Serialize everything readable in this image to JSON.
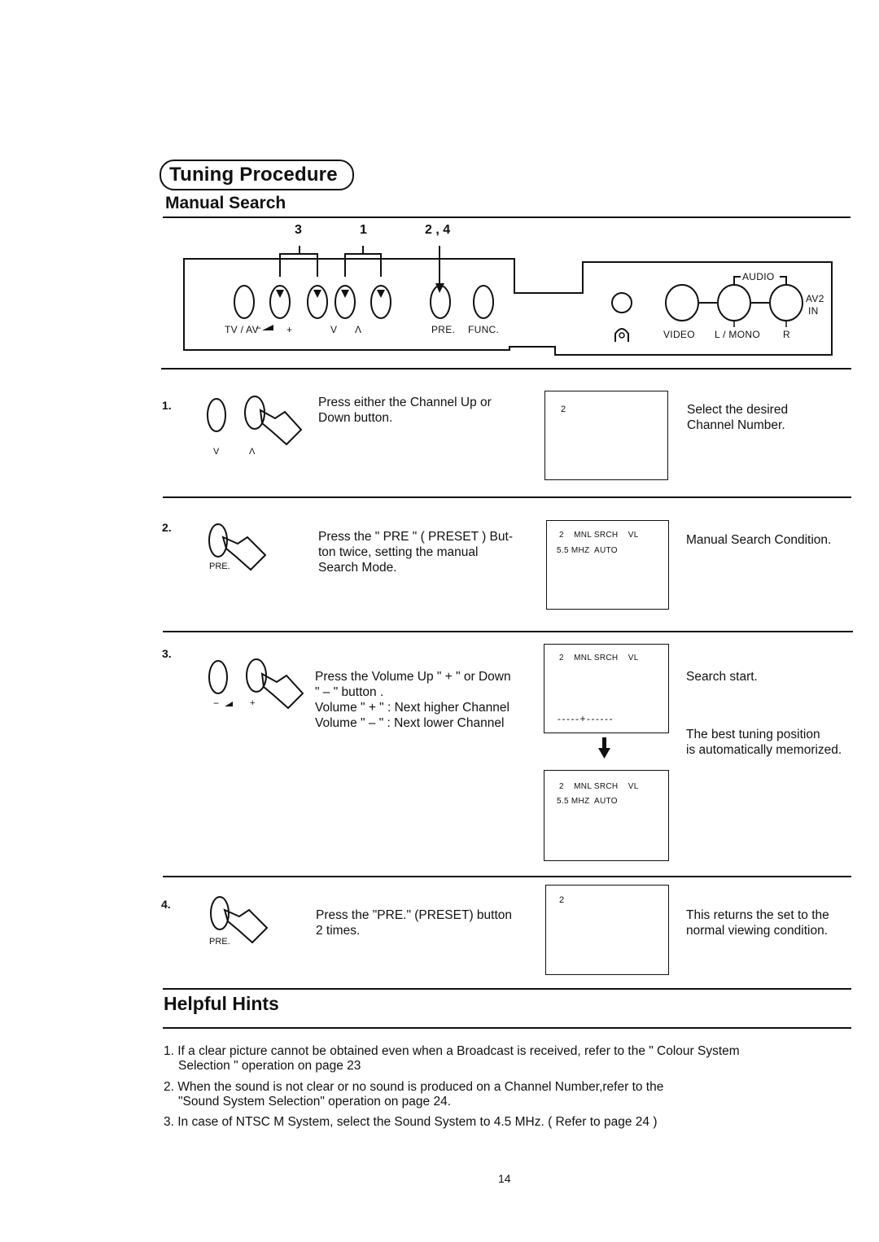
{
  "header": {
    "title": "Tuning Procedure",
    "subtitle": "Manual Search"
  },
  "panel": {
    "callouts": [
      "3",
      "1",
      "2 , 4"
    ],
    "button_labels": [
      "TV / AV",
      "−",
      "+",
      "V",
      "Λ",
      "PRE.",
      "FUNC."
    ],
    "audio_group_label": "AUDIO",
    "jack_labels": [
      "VIDEO",
      "L / MONO",
      "R"
    ],
    "av_input_label": [
      "AV2",
      "IN"
    ],
    "icons": [
      "headphone-jack-icon",
      "volume-wedge-icon"
    ]
  },
  "steps": [
    {
      "number": "1.",
      "button_labels": [
        "V",
        "Λ"
      ],
      "instruction": [
        "Press either the Channel Up or",
        "Down button."
      ],
      "osd": {
        "lines": [
          "2"
        ]
      },
      "note": [
        "Select the desired",
        "Channel Number."
      ]
    },
    {
      "number": "2.",
      "button_labels": [
        "PRE."
      ],
      "instruction": [
        "Press the \" PRE \" ( PRESET ) But-",
        "ton twice, setting the manual",
        "Search Mode."
      ],
      "osd": {
        "lines": [
          "2    MNL SRCH    VL",
          "5.5 MHZ  AUTO"
        ]
      },
      "note": [
        "Manual Search Condition."
      ]
    },
    {
      "number": "3.",
      "button_labels": [
        "−",
        "+"
      ],
      "instruction": [
        "Press the Volume Up \" + \" or Down",
        "\" – \" button .",
        "Volume \" + \" : Next higher Channel",
        "Volume \" – \"  : Next lower Channel"
      ],
      "osd": {
        "lines": [
          "2    MNL SRCH    VL"
        ],
        "tuning_bar": "-----+------"
      },
      "osd_after": {
        "lines": [
          "2    MNL SRCH    VL",
          "5.5 MHZ  AUTO"
        ]
      },
      "note": [
        "Search  start."
      ],
      "note2": [
        "The best tuning position",
        "is automatically memorized."
      ]
    },
    {
      "number": "4.",
      "button_labels": [
        "PRE."
      ],
      "instruction": [
        "Press the \"PRE.\" (PRESET) button",
        "2 times."
      ],
      "osd": {
        "lines": [
          "2"
        ]
      },
      "note": [
        "This returns the set to the",
        "normal viewing condition."
      ]
    }
  ],
  "hints": {
    "title": "Helpful Hints",
    "items": [
      [
        "1. If a clear picture cannot be obtained even when a Broadcast is received, refer to the \" Colour System",
        "Selection \" operation  on page 23"
      ],
      [
        "2. When the sound is not clear or no sound  is produced on a Channel Number,refer to the",
        "\"Sound System Selection\" operation on page 24."
      ],
      [
        "3. In case of NTSC M System, select the Sound System to 4.5 MHz. ( Refer to page 24 )"
      ]
    ]
  },
  "footer": {
    "page_number": "14"
  }
}
